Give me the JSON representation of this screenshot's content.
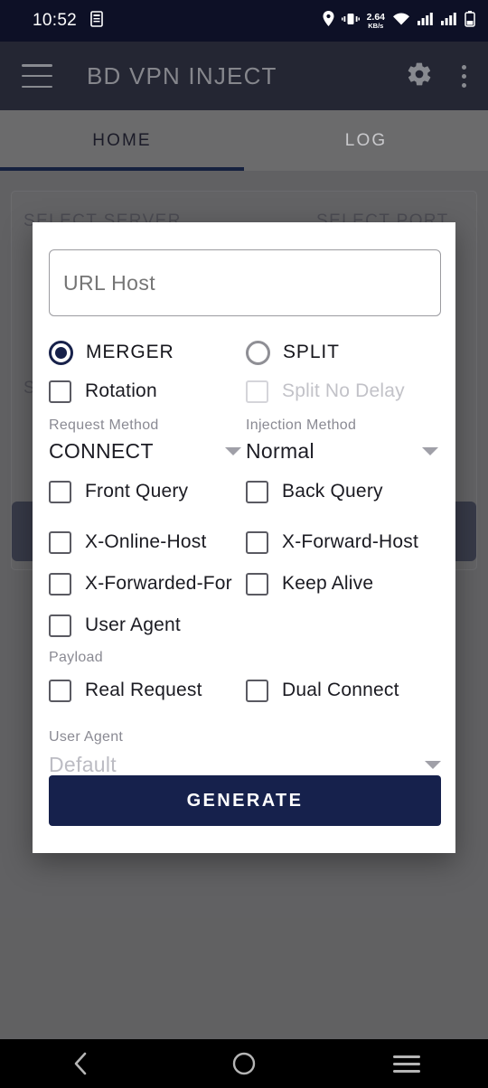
{
  "status_bar": {
    "time": "10:52",
    "net_speed_value": "2.64",
    "net_speed_unit": "KB/s",
    "icons": [
      "document-icon",
      "location-icon",
      "vibrate-icon",
      "wifi-icon",
      "signal-icon",
      "signal-icon",
      "battery-icon"
    ]
  },
  "app_bar": {
    "title": "BD VPN INJECT",
    "menu_icon": "hamburger-icon",
    "settings_icon": "gear-icon",
    "overflow_icon": "more-vertical-icon"
  },
  "tabs": [
    {
      "label": "HOME",
      "active": true
    },
    {
      "label": "LOG",
      "active": false
    }
  ],
  "background": {
    "select_server_label": "SELECT SERVER",
    "select_port_label": "SELECT PORT",
    "partial_label": "S"
  },
  "dialog": {
    "url_input": {
      "value": "",
      "placeholder": "URL Host"
    },
    "modes": [
      {
        "label": "MERGER",
        "selected": true
      },
      {
        "label": "SPLIT",
        "selected": false
      }
    ],
    "toggles_row1": [
      {
        "label": "Rotation",
        "checked": false,
        "disabled": false
      },
      {
        "label": "Split No Delay",
        "checked": false,
        "disabled": true
      }
    ],
    "selects": [
      {
        "label": "Request Method",
        "value": "CONNECT",
        "disabled": false
      },
      {
        "label": "Injection Method",
        "value": "Normal",
        "disabled": false
      }
    ],
    "toggles_row2": [
      {
        "label": "Front Query",
        "checked": false,
        "disabled": false
      },
      {
        "label": "Back Query",
        "checked": false,
        "disabled": false
      }
    ],
    "toggles_row3": [
      {
        "label": "X-Online-Host",
        "checked": false,
        "disabled": false
      },
      {
        "label": "X-Forward-Host",
        "checked": false,
        "disabled": false
      }
    ],
    "toggles_row4": [
      {
        "label": "X-Forwarded-For",
        "checked": false,
        "disabled": false
      },
      {
        "label": "Keep Alive",
        "checked": false,
        "disabled": false
      }
    ],
    "toggles_row5": [
      {
        "label": "User Agent",
        "checked": false,
        "disabled": false
      }
    ],
    "payload_section_label": "Payload",
    "toggles_row6": [
      {
        "label": "Real Request",
        "checked": false,
        "disabled": false
      },
      {
        "label": "Dual Connect",
        "checked": false,
        "disabled": false
      }
    ],
    "user_agent_select": {
      "label": "User Agent",
      "value": "Default",
      "disabled": true
    },
    "generate_button": "GENERATE"
  },
  "nav_bar": {
    "back": "back-icon",
    "home": "home-icon",
    "recents": "recents-icon"
  },
  "colors": {
    "app_bar": "#0d1026",
    "accent": "#16214c",
    "scrim": "#6a6a6a",
    "dialog_bg": "#ffffff",
    "disabled_text": "#c2c2c8"
  }
}
